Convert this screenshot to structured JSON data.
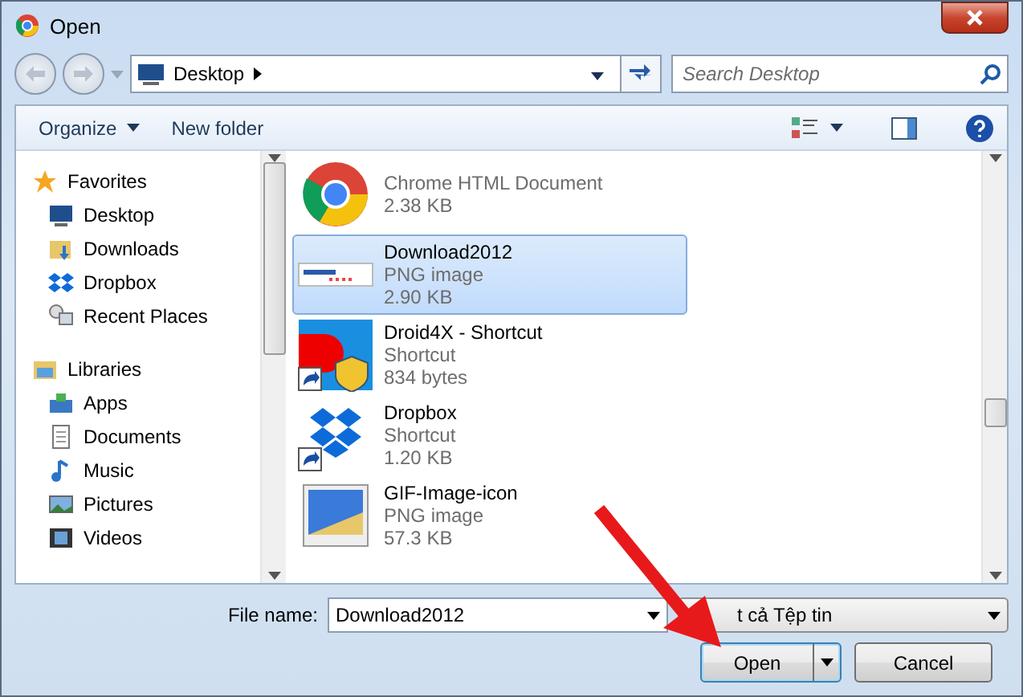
{
  "window": {
    "title": "Open"
  },
  "address": {
    "location": "Desktop"
  },
  "search": {
    "placeholder": "Search Desktop"
  },
  "toolbar": {
    "organize": "Organize",
    "new_folder": "New folder"
  },
  "sidebar": {
    "groups": [
      {
        "label": "Favorites",
        "kind": "favorites",
        "items": [
          {
            "label": "Desktop",
            "kind": "desktop"
          },
          {
            "label": "Downloads",
            "kind": "downloads"
          },
          {
            "label": "Dropbox",
            "kind": "dropbox"
          },
          {
            "label": "Recent Places",
            "kind": "recent"
          }
        ]
      },
      {
        "label": "Libraries",
        "kind": "libraries",
        "items": [
          {
            "label": "Apps",
            "kind": "apps"
          },
          {
            "label": "Documents",
            "kind": "documents"
          },
          {
            "label": "Music",
            "kind": "music"
          },
          {
            "label": "Pictures",
            "kind": "pictures"
          },
          {
            "label": "Videos",
            "kind": "videos"
          }
        ]
      }
    ]
  },
  "files": [
    {
      "kind": "chrome",
      "type": "Chrome HTML Document",
      "size": "2.38 KB",
      "selected": false
    },
    {
      "kind": "image",
      "name": "Download2012",
      "type": "PNG image",
      "size": "2.90 KB",
      "selected": true
    },
    {
      "kind": "shortcut",
      "name": "Droid4X - Shortcut",
      "type": "Shortcut",
      "size": "834 bytes",
      "selected": false
    },
    {
      "kind": "dropbox",
      "name": "Dropbox",
      "type": "Shortcut",
      "size": "1.20 KB",
      "selected": false
    },
    {
      "kind": "gif",
      "name": "GIF-Image-icon",
      "type": "PNG image",
      "size": "57.3 KB",
      "selected": false
    }
  ],
  "file_name": {
    "label": "File name:",
    "value": "Download2012"
  },
  "file_type": {
    "value": "t cả Tệp tin"
  },
  "buttons": {
    "open": "Open",
    "cancel": "Cancel"
  }
}
